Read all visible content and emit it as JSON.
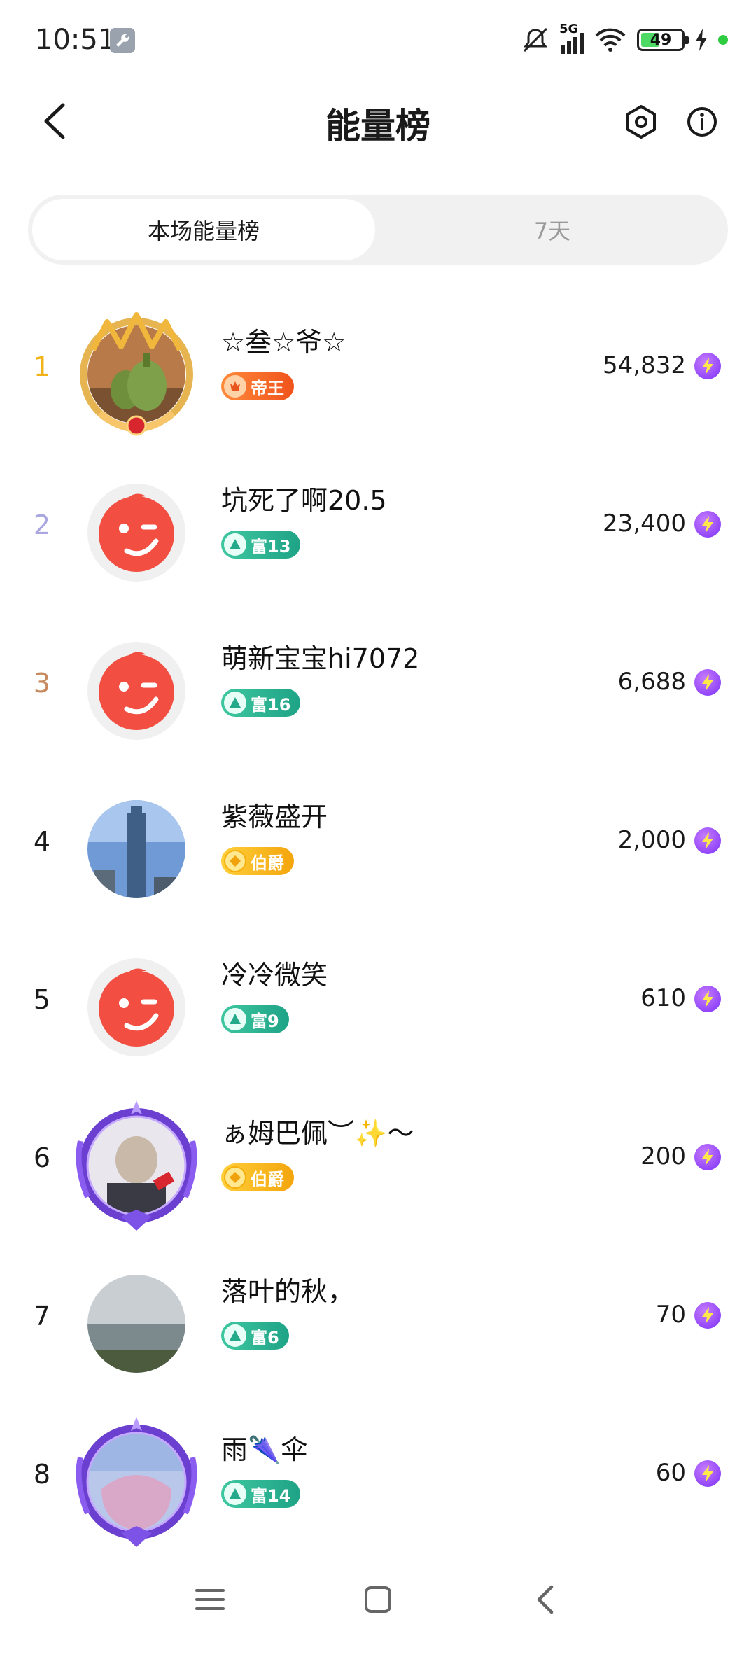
{
  "status_bar": {
    "time": "10:51",
    "network": "5G",
    "battery": "49"
  },
  "header": {
    "title": "能量榜"
  },
  "tabs": [
    {
      "label": "本场能量榜",
      "active": true
    },
    {
      "label": "7天",
      "active": false
    }
  ],
  "ranking": [
    {
      "rank": "1",
      "name": "☆叁☆爷☆",
      "badge": "帝王",
      "badge_type": "king",
      "score": "54,832",
      "rank_color": "#f2b319"
    },
    {
      "rank": "2",
      "name": "坑死了啊20.5",
      "badge": "富13",
      "badge_type": "rich",
      "score": "23,400",
      "rank_color": "#a9a6e0"
    },
    {
      "rank": "3",
      "name": "萌新宝宝hi7072",
      "badge": "富16",
      "badge_type": "rich",
      "score": "6,688",
      "rank_color": "#c68a5e"
    },
    {
      "rank": "4",
      "name": "紫薇盛开",
      "badge": "伯爵",
      "badge_type": "gold",
      "score": "2,000",
      "rank_color": "#1a1a1a"
    },
    {
      "rank": "5",
      "name": "冷冷微笑",
      "badge": "富9",
      "badge_type": "rich",
      "score": "610",
      "rank_color": "#1a1a1a"
    },
    {
      "rank": "6",
      "name": "ぁ姆巴佩︶✨～",
      "badge": "伯爵",
      "badge_type": "gold",
      "score": "200",
      "rank_color": "#1a1a1a"
    },
    {
      "rank": "7",
      "name": "落叶的秋，",
      "badge": "富6",
      "badge_type": "rich",
      "score": "70",
      "rank_color": "#1a1a1a"
    },
    {
      "rank": "8",
      "name": "雨🌂伞",
      "badge": "富14",
      "badge_type": "rich",
      "score": "60",
      "rank_color": "#1a1a1a"
    }
  ],
  "icons": {
    "back": "chevron-left-icon",
    "settings": "hexagon-settings-icon",
    "info": "info-icon",
    "energy": "lightning-icon"
  }
}
